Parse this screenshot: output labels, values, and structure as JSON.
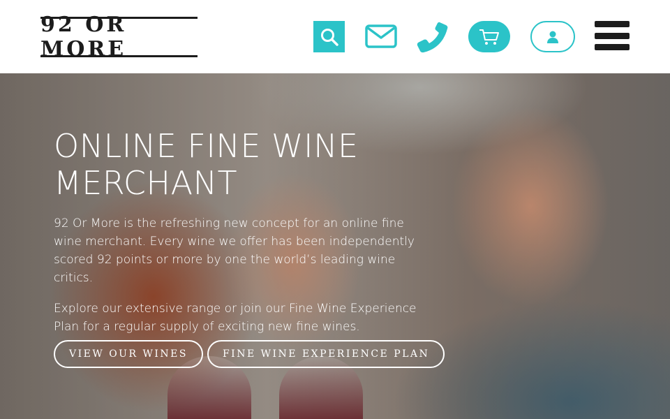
{
  "header": {
    "logo_text": "92 OR MORE",
    "icons": {
      "search": "search-icon",
      "mail": "mail-icon",
      "phone": "phone-icon",
      "cart": "cart-icon",
      "user": "user-icon",
      "menu": "hamburger-menu-icon"
    },
    "accent_color": "#2bc3c8"
  },
  "hero": {
    "title": "ONLINE FINE WINE MERCHANT",
    "paragraph_1": "92 Or More is the refreshing new concept for an online fine wine merchant. Every wine we offer has been independently scored 92 points or more by one the world’s leading wine critics.",
    "paragraph_2": "Explore our extensive range or join our Fine Wine Experience Plan for a regular supply of exciting new fine wines.",
    "buttons": [
      {
        "label": "VIEW OUR WINES"
      },
      {
        "label": "FINE WINE EXPERIENCE PLAN"
      }
    ]
  }
}
